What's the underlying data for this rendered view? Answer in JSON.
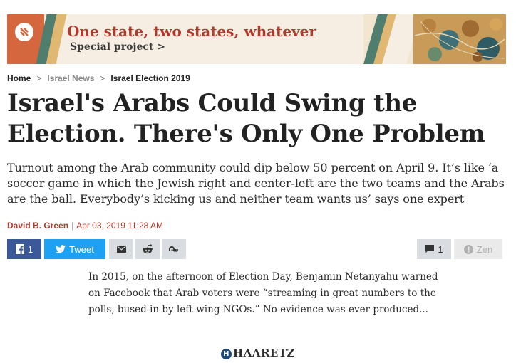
{
  "banner": {
    "title": "One state, two states, whatever",
    "subtitle": "Special project >",
    "logo_icon": "haaretz-logo-icon",
    "colors": {
      "accent": "#b03a2e",
      "orange": "#d4673d",
      "green": "#4f7d6e",
      "sand": "#e0b872",
      "bg": "#f6eee3"
    }
  },
  "breadcrumb": {
    "items": [
      "Home",
      "Israel News",
      "Israel Election 2019"
    ],
    "separator": ">"
  },
  "article": {
    "headline": "Israel's Arabs Could Swing the Election. There's Only One Problem",
    "subtitle": "Turnout among the Arab community could dip below 50 percent on April 9. It’s like ‘a soccer game in which the Jewish right and center-left are the two teams and the Arabs are the ball. Everybody’s kicking us and neither team wants us’ says one expert",
    "author": "David B. Green",
    "byline_sep": "|",
    "date": "Apr 03, 2019 11:28 AM",
    "teaser": "In 2015, on the afternoon of Election Day, Benjamin Netanyahu warned on Facebook that Arab voters were “streaming in great numbers to the polls, bused in by left-wing NGOs.” No evidence was ever produced..."
  },
  "share": {
    "facebook_count": "1",
    "tweet_label": "Tweet",
    "comments_count": "1",
    "zen_label": "Zen",
    "icons": [
      "facebook-icon",
      "twitter-icon",
      "email-icon",
      "reddit-icon",
      "stumbleupon-icon",
      "comment-icon",
      "zen-icon"
    ],
    "colors": {
      "facebook": "#3b5998",
      "twitter": "#1da1f2"
    }
  },
  "footer": {
    "brand": "HAARETZ",
    "brand_mark": "H"
  }
}
